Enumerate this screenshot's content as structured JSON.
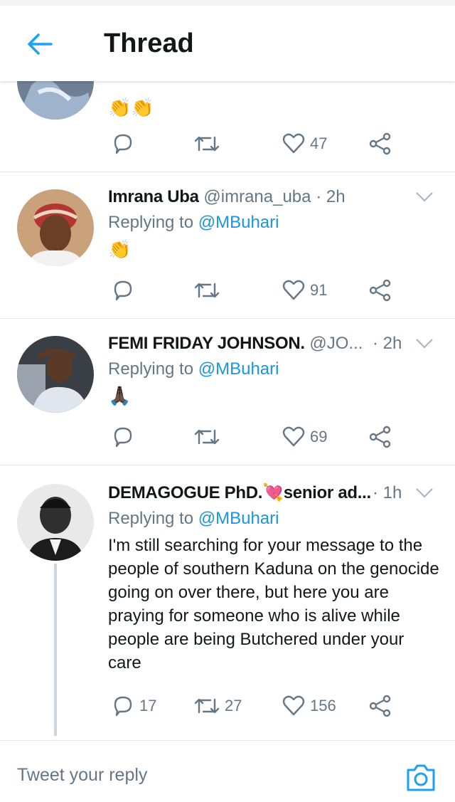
{
  "header": {
    "title": "Thread"
  },
  "tweets": [
    {
      "emoji": "👏👏",
      "actions": {
        "reply": "",
        "retweet": "",
        "like": "47"
      }
    },
    {
      "name": "Imrana Uba",
      "handle": "@imrana_uba",
      "time": "· 2h",
      "replying_prefix": "Replying to",
      "replying_to": "@MBuhari",
      "emoji": "👏",
      "actions": {
        "reply": "",
        "retweet": "",
        "like": "91"
      }
    },
    {
      "name": "FEMI FRIDAY JOHNSON.",
      "handle": "@JO...",
      "time": "· 2h",
      "replying_prefix": "Replying to",
      "replying_to": "@MBuhari",
      "emoji": "🙏🏿",
      "actions": {
        "reply": "",
        "retweet": "",
        "like": "69"
      }
    },
    {
      "name": "DEMAGOGUE PhD.💘senior ad...",
      "time": "· 1h",
      "replying_prefix": "Replying to",
      "replying_to": "@MBuhari",
      "text": "I'm still searching for your message to the people of southern Kaduna on the genocide going on over there, but here you are praying for someone who is alive while people are being Butchered under your care",
      "actions": {
        "reply": "17",
        "retweet": "27",
        "like": "156"
      }
    }
  ],
  "reply_bar": {
    "placeholder": "Tweet your reply"
  },
  "colors": {
    "accent": "#1da1f2",
    "text": "#14171a",
    "secondary": "#657786",
    "divider": "#e1e8ed"
  },
  "icons": [
    "back-arrow-icon",
    "reply-icon",
    "retweet-icon",
    "like-icon",
    "share-icon",
    "chevron-down-icon",
    "camera-icon"
  ]
}
